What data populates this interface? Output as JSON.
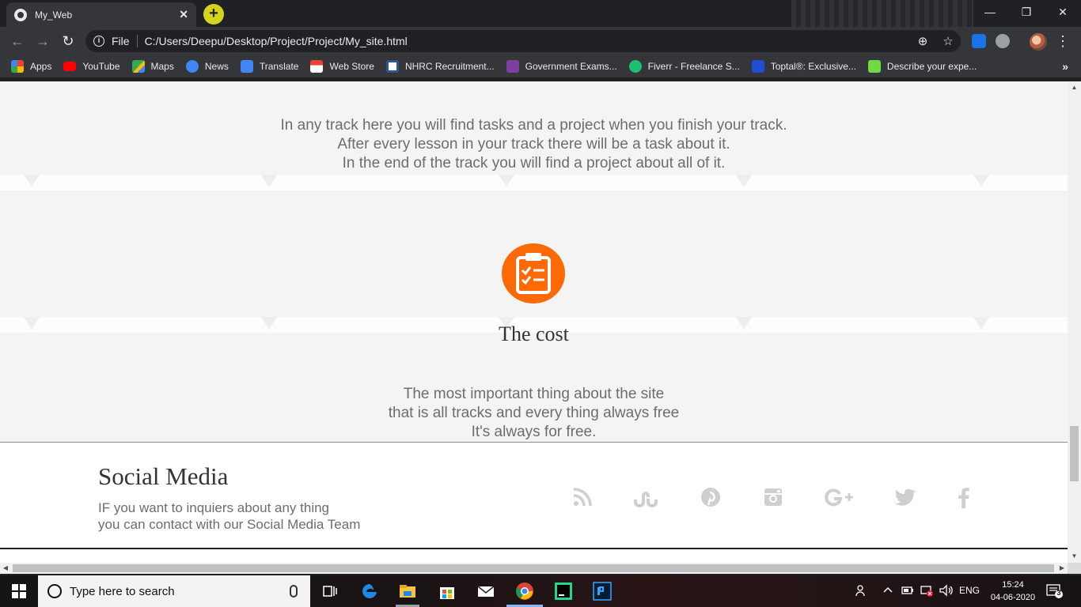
{
  "browser": {
    "tab_title": "My_Web",
    "tab_close": "✕",
    "new_tab": "+",
    "url_scheme": "File",
    "url": "C:/Users/Deepu/Desktop/Project/Project/My_site.html",
    "window_controls": {
      "minimize": "—",
      "restore": "❐",
      "close": "✕"
    },
    "nav": {
      "back": "←",
      "forward": "→",
      "reload": "↻"
    },
    "omnibox_icons": {
      "zoom": "⊕",
      "star": "☆"
    },
    "menu": "⋮",
    "bookmarks": [
      {
        "label": "Apps",
        "icon": "apps-grid-icon",
        "color": "#4285f4"
      },
      {
        "label": "YouTube",
        "icon": "youtube-icon",
        "color": "#ff0000"
      },
      {
        "label": "Maps",
        "icon": "maps-icon",
        "color": "#34a853"
      },
      {
        "label": "News",
        "icon": "news-icon",
        "color": "#4285f4"
      },
      {
        "label": "Translate",
        "icon": "translate-icon",
        "color": "#4285f4"
      },
      {
        "label": "Web Store",
        "icon": "webstore-icon",
        "color": "#ea4335"
      },
      {
        "label": "NHRC Recruitment...",
        "icon": "nhrc-icon",
        "color": "#2b5797"
      },
      {
        "label": "Government Exams...",
        "icon": "exams-icon",
        "color": "#7b3fa0"
      },
      {
        "label": "Fiverr - Freelance S...",
        "icon": "fiverr-icon",
        "color": "#1dbf73"
      },
      {
        "label": "Toptal®: Exclusive...",
        "icon": "toptal-icon",
        "color": "#204ecf"
      },
      {
        "label": "Describe your expe...",
        "icon": "upwork-icon",
        "color": "#6fda44"
      }
    ],
    "bookmarks_more": "»"
  },
  "page": {
    "tracks_text": [
      "In any track here you will find tasks and a project when you finish your track.",
      "After every lesson in your track there will be a task about it.",
      "In the end of the track you will find a project about all of it."
    ],
    "cost_icon": "clipboard-checklist-icon",
    "cost_icon_color": "#fb6a07",
    "cost_title": "The cost",
    "cost_text": [
      "The most important thing about the site",
      "that is all tracks and every thing always free",
      "It's always for free."
    ],
    "footer": {
      "title": "Social Media",
      "text_line1": "IF you want to inquiers about any thing",
      "text_line2": "you can contact with our Social Media Team",
      "social_icons": [
        "rss-icon",
        "stumbleupon-icon",
        "pinterest-icon",
        "instagram-icon",
        "google-plus-icon",
        "twitter-icon",
        "facebook-icon"
      ],
      "icon_color": "#cfcfcf"
    }
  },
  "taskbar": {
    "search_placeholder": "Type here to search",
    "apps": [
      "task-view-icon",
      "edge-icon",
      "file-explorer-icon",
      "store-icon",
      "mail-icon",
      "chrome-icon",
      "pycharm-icon",
      "photoshop-icon"
    ],
    "language": "ENG",
    "time": "15:24",
    "date": "04-06-2020",
    "notifications": "3"
  }
}
